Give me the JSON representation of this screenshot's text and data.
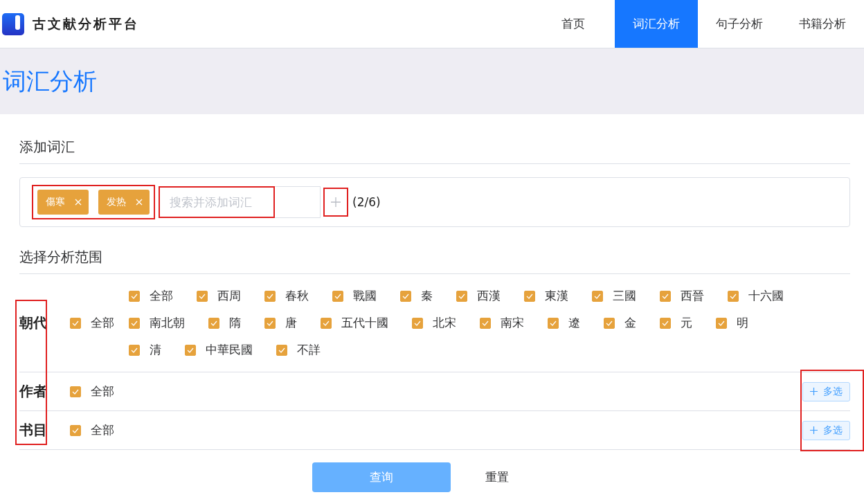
{
  "header": {
    "logo_text": "古文献分析平台",
    "nav": [
      {
        "label": "首页",
        "selected": false
      },
      {
        "label": "词汇分析",
        "selected": true
      },
      {
        "label": "句子分析",
        "selected": false
      },
      {
        "label": "书籍分析",
        "selected": false
      }
    ]
  },
  "page_title": "词汇分析",
  "add_words": {
    "heading": "添加词汇",
    "tags": [
      {
        "label": "傷寒"
      },
      {
        "label": "发热"
      }
    ],
    "search": {
      "placeholder": "搜索并添加词汇"
    },
    "count": "(2/6)"
  },
  "range": {
    "heading": "选择分析范围",
    "rows": [
      {
        "label": "朝代",
        "all": {
          "label": "全部",
          "checked": true
        },
        "options": [
          {
            "label": "全部",
            "checked": true
          },
          {
            "label": "西周",
            "checked": true
          },
          {
            "label": "春秋",
            "checked": true
          },
          {
            "label": "戰國",
            "checked": true
          },
          {
            "label": "秦",
            "checked": true
          },
          {
            "label": "西漢",
            "checked": true
          },
          {
            "label": "東漢",
            "checked": true
          },
          {
            "label": "三國",
            "checked": true
          },
          {
            "label": "西晉",
            "checked": true
          },
          {
            "label": "十六國",
            "checked": true
          },
          {
            "label": "南北朝",
            "checked": true
          },
          {
            "label": "隋",
            "checked": true
          },
          {
            "label": "唐",
            "checked": true
          },
          {
            "label": "五代十國",
            "checked": true
          },
          {
            "label": "北宋",
            "checked": true
          },
          {
            "label": "南宋",
            "checked": true
          },
          {
            "label": "遼",
            "checked": true
          },
          {
            "label": "金",
            "checked": true
          },
          {
            "label": "元",
            "checked": true
          },
          {
            "label": "明",
            "checked": true
          },
          {
            "label": "清",
            "checked": true
          },
          {
            "label": "中華民國",
            "checked": true
          },
          {
            "label": "不詳",
            "checked": true
          }
        ]
      },
      {
        "label": "作者",
        "all": {
          "label": "全部",
          "checked": true
        },
        "button": "多选"
      },
      {
        "label": "书目",
        "all": {
          "label": "全部",
          "checked": true
        },
        "button": "多选"
      }
    ]
  },
  "actions": {
    "submit": "查询",
    "reset": "重置"
  }
}
